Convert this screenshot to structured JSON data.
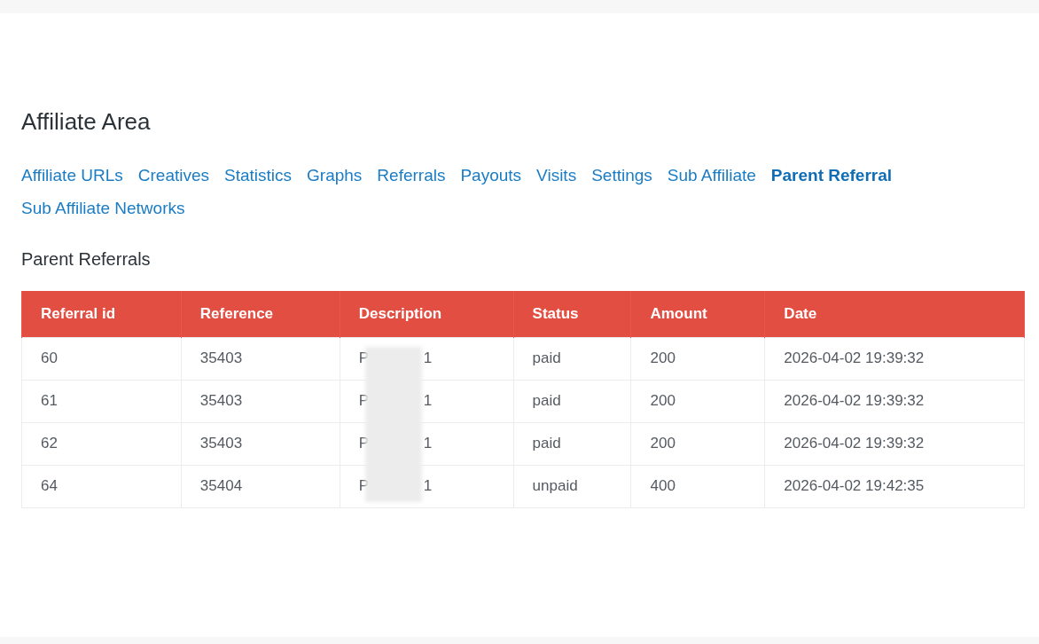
{
  "page_title": "Affiliate Area",
  "tabs": [
    {
      "label": "Affiliate URLs",
      "selected": false
    },
    {
      "label": "Creatives",
      "selected": false
    },
    {
      "label": "Statistics",
      "selected": false
    },
    {
      "label": "Graphs",
      "selected": false
    },
    {
      "label": "Referrals",
      "selected": false
    },
    {
      "label": "Payouts",
      "selected": false
    },
    {
      "label": "Visits",
      "selected": false
    },
    {
      "label": "Settings",
      "selected": false
    },
    {
      "label": "Sub Affiliate",
      "selected": false
    },
    {
      "label": "Parent Referral",
      "selected": true
    },
    {
      "label": "Sub Affiliate Networks",
      "selected": false
    }
  ],
  "section_title": "Parent Referrals",
  "table": {
    "columns": [
      "Referral id",
      "Reference",
      "Description",
      "Status",
      "Amount",
      "Date"
    ],
    "rows": [
      {
        "referral_id": "60",
        "reference": "35403",
        "description_start": "P",
        "description_end": "1",
        "status": "paid",
        "amount": "200",
        "date": "2026-04-02 19:39:32"
      },
      {
        "referral_id": "61",
        "reference": "35403",
        "description_start": "P",
        "description_end": "1",
        "status": "paid",
        "amount": "200",
        "date": "2026-04-02 19:39:32"
      },
      {
        "referral_id": "62",
        "reference": "35403",
        "description_start": "P",
        "description_end": "1",
        "status": "paid",
        "amount": "200",
        "date": "2026-04-02 19:39:32"
      },
      {
        "referral_id": "64",
        "reference": "35404",
        "description_start": "P",
        "description_end": "1",
        "status": "unpaid",
        "amount": "400",
        "date": "2026-04-02 19:42:35"
      }
    ]
  }
}
